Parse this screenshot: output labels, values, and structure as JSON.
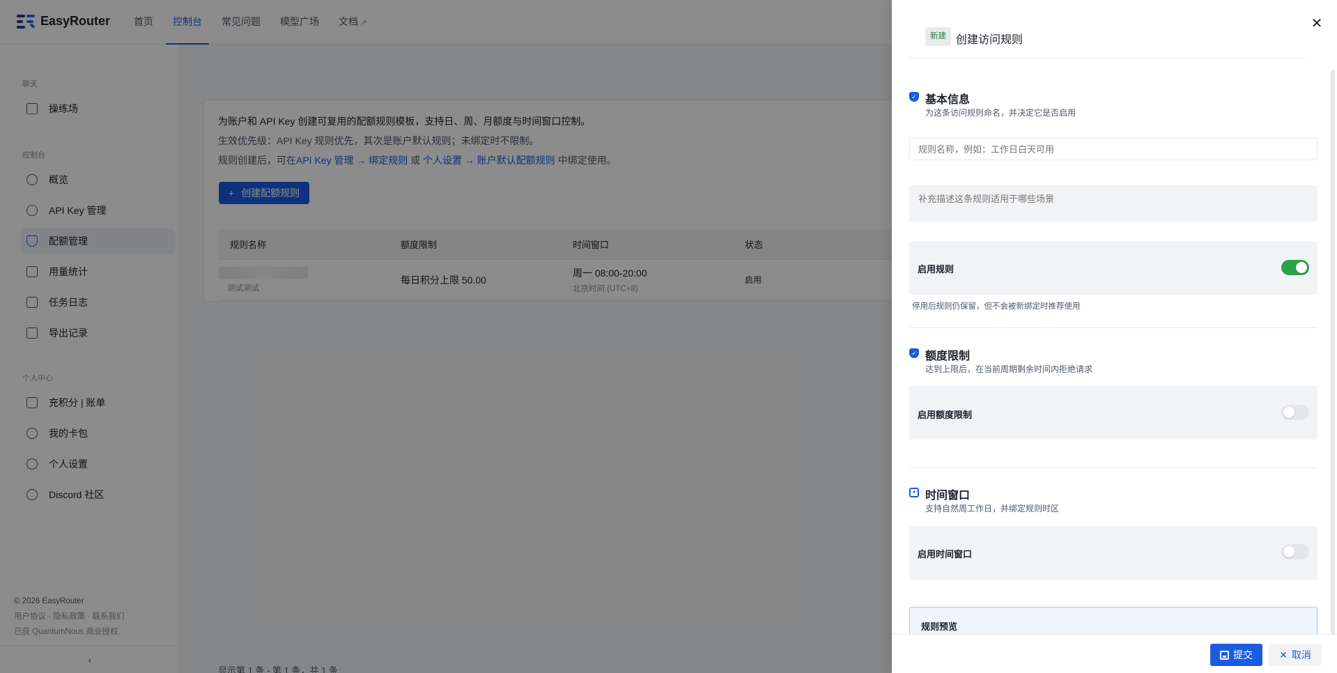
{
  "app": {
    "brand": "EasyRouter",
    "nav": [
      "首页",
      "控制台",
      "常见问题",
      "模型广场",
      "文档"
    ],
    "active_nav": "控制台"
  },
  "sidebar": {
    "group_chat": "聊天",
    "group_console": "控制台",
    "group_personal": "个人中心",
    "items": {
      "playground": "操练场",
      "overview": "概览",
      "apikey": "API Key 管理",
      "quota": "配额管理",
      "usage": "用量统计",
      "tasklog": "任务日志",
      "export": "导出记录",
      "recharge": "充积分 | 账单",
      "wallet": "我的卡包",
      "settings": "个人设置",
      "discord": "Discord 社区"
    },
    "active_item": "配额管理",
    "footer": {
      "copyright": "© 2026 EasyRouter",
      "links": "用户协议 · 隐私政策 · 联系我们",
      "license": "已获 QuantumNous 商业授权"
    },
    "collapse": "‹"
  },
  "main": {
    "info_line1": "为账户和 API Key 创建可复用的配额规则模板，支持日、周、月额度与时间窗口控制。",
    "info_line2": "生效优先级：API Key 规则优先，其次是账户默认规则；未绑定时不限制。",
    "info_line3_a": "规则创建后，可在",
    "info_line3_link1": "API Key 管理 → 绑定规则",
    "info_line3_b": " 或 ",
    "info_line3_link2": "个人设置 → 账户默认配额规则",
    "info_line3_c": " 中绑定使用。",
    "create_button": "创建配额规则",
    "table": {
      "headers": [
        "规则名称",
        "额度限制",
        "时间窗口",
        "状态"
      ],
      "rows": [
        {
          "name_sub": "测试测试",
          "limit": "每日积分上限 50.00",
          "window": "周一 08:00-20:00",
          "window_sub": "北京时间 (UTC+8)",
          "status": "启用"
        }
      ]
    },
    "pagination": "显示第 1 条 - 第 1 条，共 1 条"
  },
  "drawer": {
    "tag": "新建",
    "title": "创建访问规则",
    "basic": {
      "title": "基本信息",
      "desc": "为这条访问规则命名，并决定它是否启用",
      "name_placeholder": "规则名称，例如：工作日白天可用",
      "desc_placeholder": "补充描述这条规则适用于哪些场景",
      "enable_label": "启用规则",
      "enabled": true,
      "enable_hint": "停用后规则仍保留，但不会被新绑定时推荐使用"
    },
    "quota": {
      "title": "额度限制",
      "desc": "达到上限后，在当前周期剩余时间内拒绝请求",
      "enable_label": "启用额度限制",
      "enabled": false
    },
    "time": {
      "title": "时间窗口",
      "desc": "支持自然周工作日，并绑定规则时区",
      "enable_label": "启用时间窗口",
      "enabled": false
    },
    "preview_title": "规则预览",
    "submit": "提交",
    "cancel": "取消"
  },
  "colors": {
    "primary": "#1a5ce0",
    "switch_on": "#2ea14a"
  }
}
